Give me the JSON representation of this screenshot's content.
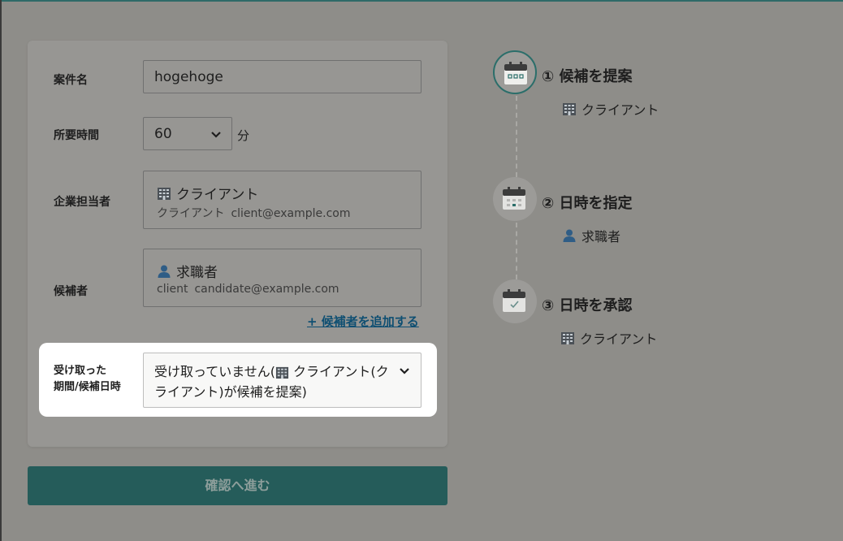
{
  "form": {
    "project_name": {
      "label": "案件名",
      "value": "hogehoge"
    },
    "duration": {
      "label": "所要時間",
      "value": "60",
      "unit": "分"
    },
    "company_rep": {
      "label": "企業担当者",
      "name": "クライアント",
      "sub_name": "クライアント",
      "email": "client@example.com"
    },
    "candidate": {
      "label": "候補者",
      "name": "求職者",
      "sub_name": "client",
      "email": "candidate@example.com",
      "add_link": "+ 候補者を追加する"
    },
    "received": {
      "label_line1": "受け取った",
      "label_line2": "期間/候補日時",
      "value_line1_prefix": "受け取っていません(",
      "value_line1_suffix": " クライアント(ク",
      "value_line2": "ライアント)が候補を提案)"
    },
    "confirm_button": "確認へ進む"
  },
  "steps": [
    {
      "title": "① 候補を提案",
      "actor": "クライアント",
      "actor_icon": "building-icon",
      "state": "active"
    },
    {
      "title": "② 日時を指定",
      "actor": "求職者",
      "actor_icon": "user-icon",
      "state": "inactive"
    },
    {
      "title": "③ 日時を承認",
      "actor": "クライアント",
      "actor_icon": "building-icon",
      "state": "inactive"
    }
  ],
  "colors": {
    "accent": "#255c5a",
    "link": "#0f4f72",
    "overlay": "#8e8d89"
  }
}
